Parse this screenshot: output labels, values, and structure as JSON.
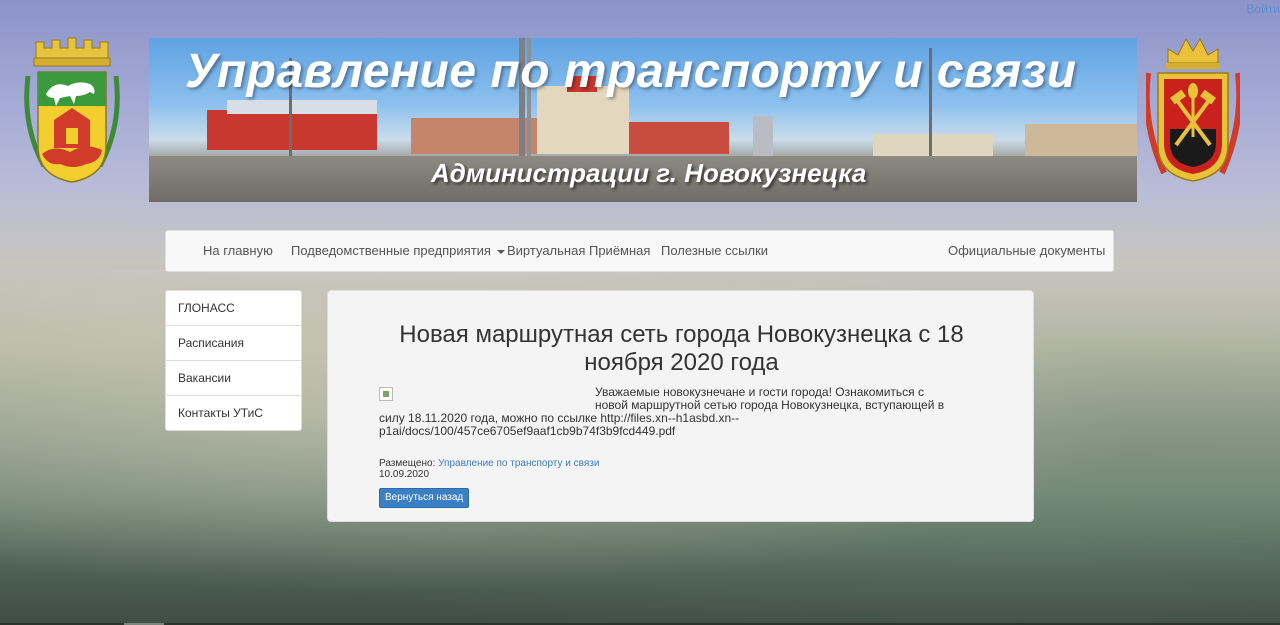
{
  "header": {
    "login_link": "Войти",
    "banner_title": "Управление по транспорту и связи",
    "banner_subtitle": "Администрации г. Новокузнецка"
  },
  "nav": {
    "items": [
      "На главную",
      "Подведомственные предприятия",
      "Виртуальная Приёмная",
      "Полезные ссылки"
    ],
    "right_item": "Официальные документы"
  },
  "sidebar": {
    "items": [
      "ГЛОНАСС",
      "Расписания",
      "Вакансии",
      "Контакты УТиС"
    ]
  },
  "article": {
    "title": "Новая маршрутная сеть города Новокузнецка с 18 ноября 2020 года",
    "body": "Уважаемые новокузнечане и гости города! Ознакомиться с новой маршрутной сетью города Новокузнецка, вступающей в силу 18.11.2020 года, можно по ссылке http://files.xn--h1asbd.xn--p1ai/docs/100/457ce6705ef9aaf1cb9b74f3b9fcd449.pdf",
    "posted_label": "Размещено:",
    "posted_by": "Управление по транспорту и связи",
    "date": "10.09.2020",
    "back_button": "Вернуться назад"
  },
  "colors": {
    "accent": "#3b7fc4",
    "link": "#3f7cc0",
    "navbar_bg": "#f8f8f8"
  }
}
